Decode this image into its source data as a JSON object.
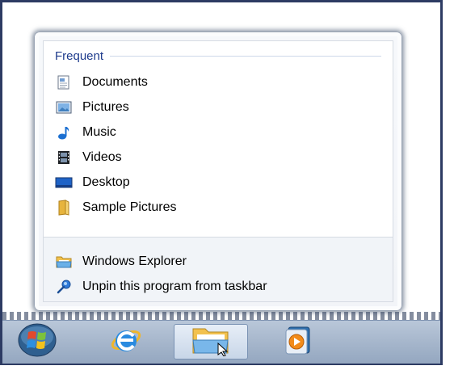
{
  "jumplist": {
    "section_title": "Frequent",
    "frequent": [
      {
        "label": "Documents",
        "icon": "documents-icon"
      },
      {
        "label": "Pictures",
        "icon": "pictures-icon"
      },
      {
        "label": "Music",
        "icon": "music-icon"
      },
      {
        "label": "Videos",
        "icon": "videos-icon"
      },
      {
        "label": "Desktop",
        "icon": "desktop-icon"
      },
      {
        "label": "Sample Pictures",
        "icon": "folder-icon"
      }
    ],
    "tasks": [
      {
        "label": "Windows Explorer",
        "icon": "windows-explorer-icon"
      },
      {
        "label": "Unpin this program from taskbar",
        "icon": "unpin-icon"
      }
    ]
  },
  "taskbar": {
    "items": [
      {
        "name": "start-button",
        "icon": "windows-orb-icon"
      },
      {
        "name": "internet-explorer-button",
        "icon": "internet-explorer-icon"
      },
      {
        "name": "windows-explorer-button",
        "icon": "folder-icon",
        "active": true
      },
      {
        "name": "media-player-button",
        "icon": "media-player-icon"
      }
    ]
  },
  "colors": {
    "section_title": "#1e3b8c",
    "taskbar": "#a8b8cd",
    "frame_border": "#2d3b63"
  }
}
